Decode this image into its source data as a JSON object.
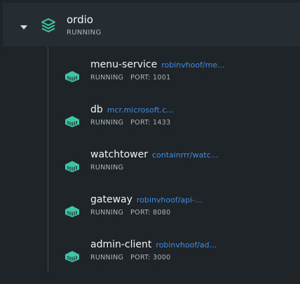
{
  "group": {
    "name": "ordio",
    "status": "RUNNING",
    "icon": "stack-icon",
    "accent": "#3dc7a6"
  },
  "containers": [
    {
      "name": "menu-service",
      "image": "robinvhoof/me...",
      "status": "RUNNING",
      "port": "PORT: 1001"
    },
    {
      "name": "db",
      "image": "mcr.microsoft.c...",
      "status": "RUNNING",
      "port": "PORT: 1433"
    },
    {
      "name": "watchtower",
      "image": "containrrr/watc...",
      "status": "RUNNING",
      "port": ""
    },
    {
      "name": "gateway",
      "image": "robinvhoof/api-...",
      "status": "RUNNING",
      "port": "PORT: 8080"
    },
    {
      "name": "admin-client",
      "image": "robinvhoof/ad...",
      "status": "RUNNING",
      "port": "PORT: 3000"
    }
  ]
}
